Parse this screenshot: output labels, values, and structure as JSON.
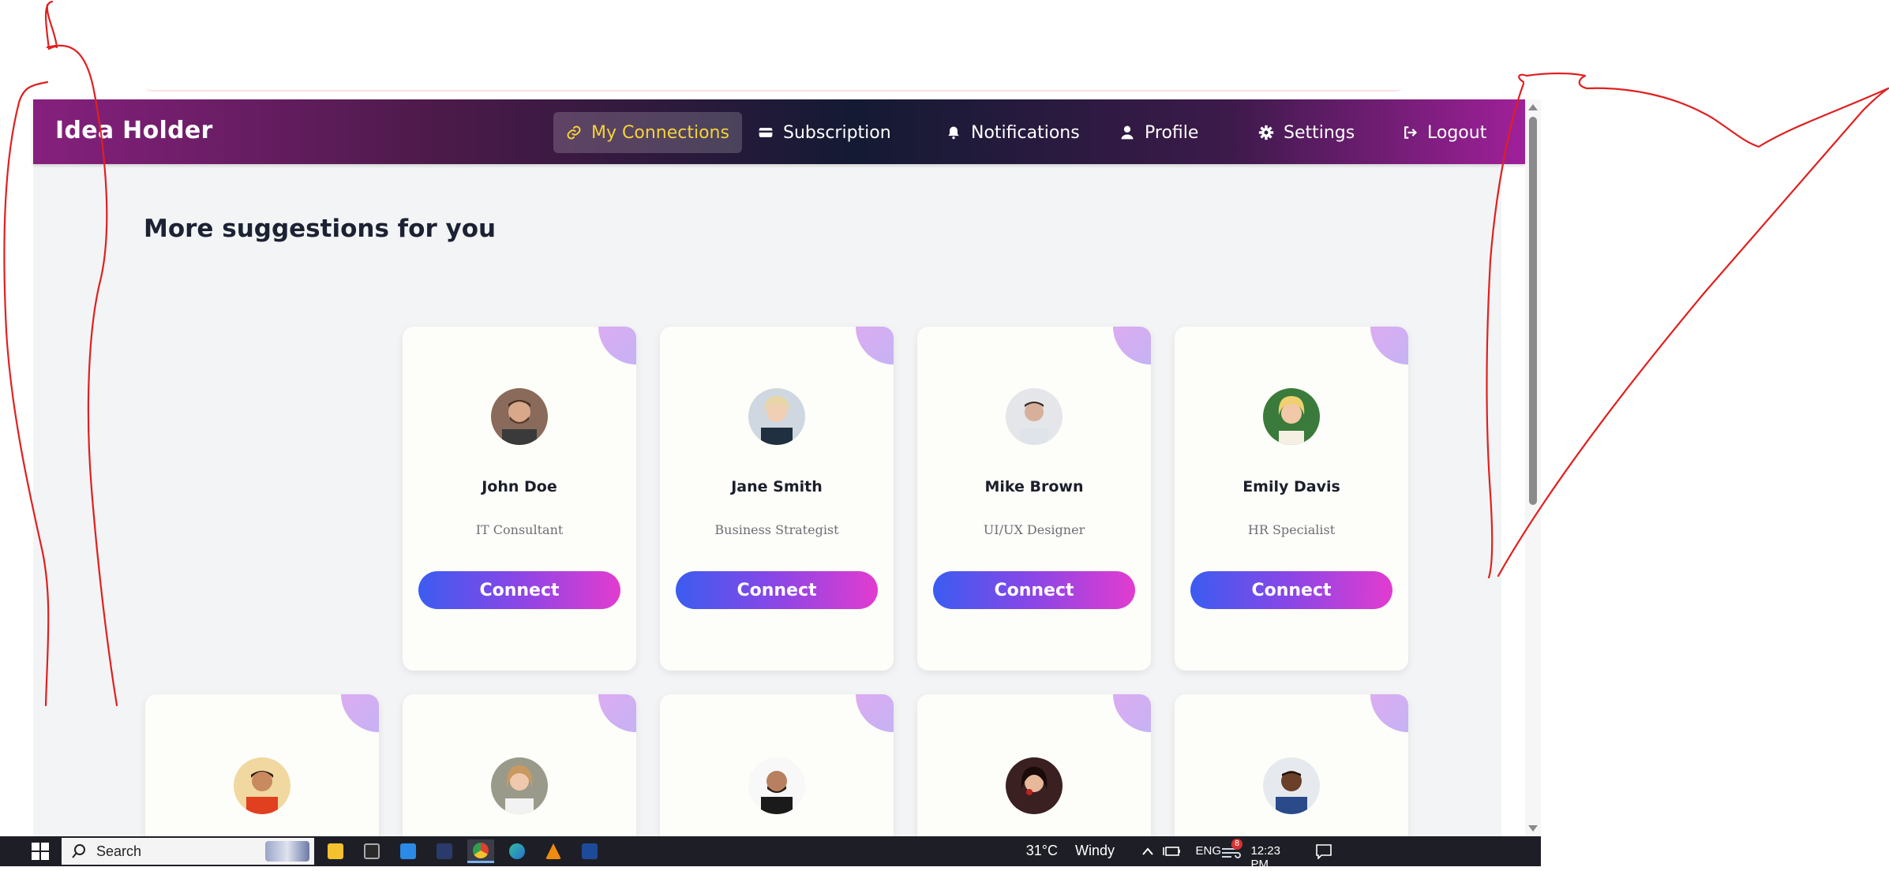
{
  "navbar": {
    "brand": "Idea Holder",
    "items": [
      {
        "label": "My Connections",
        "icon": "link-icon",
        "active": true
      },
      {
        "label": "Subscription",
        "icon": "credit-card-icon",
        "active": false
      },
      {
        "label": "Notifications",
        "icon": "bell-icon",
        "active": false
      },
      {
        "label": "Profile",
        "icon": "user-icon",
        "active": false
      },
      {
        "label": "Settings",
        "icon": "gear-icon",
        "active": false
      },
      {
        "label": "Logout",
        "icon": "logout-icon",
        "active": false
      }
    ]
  },
  "main": {
    "section_title": "More suggestions for you",
    "cards_row1": [
      {
        "name": "John Doe",
        "role": "IT Consultant",
        "button": "Connect"
      },
      {
        "name": "Jane Smith",
        "role": "Business Strategist",
        "button": "Connect"
      },
      {
        "name": "Mike Brown",
        "role": "UI/UX Designer",
        "button": "Connect"
      },
      {
        "name": "Emily Davis",
        "role": "HR Specialist",
        "button": "Connect"
      }
    ]
  },
  "taskbar": {
    "search_label": "Search",
    "notification_badge": "8",
    "temperature": "31°C",
    "weather": "Windy",
    "language": "ENG",
    "time": "12:23 PM"
  },
  "colors": {
    "accent_active": "#f5d33a",
    "button_gradient_start": "#3b5cf0",
    "button_gradient_end": "#e23ccf",
    "annotation": "#e02020"
  }
}
